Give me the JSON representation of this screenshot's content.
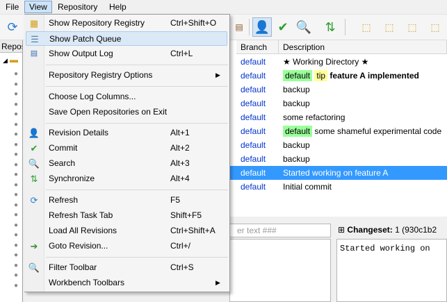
{
  "menubar": {
    "items": [
      {
        "label": "File"
      },
      {
        "label": "View"
      },
      {
        "label": "Repository"
      },
      {
        "label": "Help"
      }
    ]
  },
  "left_panel": {
    "header": "Repos"
  },
  "columns": {
    "branch": "Branch",
    "description": "Description"
  },
  "revisions": [
    {
      "branch": "default",
      "prefix": "★ ",
      "text": "Working Directory",
      "suffix": " ★"
    },
    {
      "branch": "default",
      "tags": [
        "default",
        "tip"
      ],
      "text": "feature A implemented"
    },
    {
      "branch": "default",
      "text": "backup"
    },
    {
      "branch": "default",
      "text": "backup"
    },
    {
      "branch": "default",
      "text": "some refactoring"
    },
    {
      "branch": "default",
      "tags": [
        "default"
      ],
      "text": "some shameful experimental code"
    },
    {
      "branch": "default",
      "text": "backup"
    },
    {
      "branch": "default",
      "text": "backup"
    },
    {
      "branch": "default",
      "text": "Started working on feature A"
    },
    {
      "branch": "default",
      "text": "Initial commit"
    }
  ],
  "filter": {
    "placeholder": "er text ###"
  },
  "changeset": {
    "toggle": "⊞",
    "label": "Changeset:",
    "value": "1 (930c1b2",
    "message": "Started working on"
  },
  "view_menu": {
    "items": [
      {
        "label": "Show Repository Registry",
        "shortcut": "Ctrl+Shift+O",
        "icon": "repository-registry-icon"
      },
      {
        "label": "Show Patch Queue",
        "shortcut": "",
        "icon": "patch-queue-icon"
      },
      {
        "label": "Show Output Log",
        "shortcut": "Ctrl+L",
        "icon": "output-log-icon"
      },
      {
        "label": "Repository Registry Options",
        "shortcut": "",
        "submenu": true
      },
      {
        "label": "Choose Log Columns...",
        "shortcut": ""
      },
      {
        "label": "Save Open Repositories on Exit",
        "shortcut": ""
      },
      {
        "label": "Revision Details",
        "shortcut": "Alt+1",
        "icon": "revision-details-icon"
      },
      {
        "label": "Commit",
        "shortcut": "Alt+2",
        "icon": "checkmark-icon"
      },
      {
        "label": "Search",
        "shortcut": "Alt+3",
        "icon": "search-icon"
      },
      {
        "label": "Synchronize",
        "shortcut": "Alt+4",
        "icon": "synchronize-icon"
      },
      {
        "label": "Refresh",
        "shortcut": "F5",
        "icon": "refresh-icon"
      },
      {
        "label": "Refresh Task Tab",
        "shortcut": "Shift+F5"
      },
      {
        "label": "Load All Revisions",
        "shortcut": "Ctrl+Shift+A"
      },
      {
        "label": "Goto Revision...",
        "shortcut": "Ctrl+/",
        "icon": "goto-revision-icon"
      },
      {
        "label": "Filter Toolbar",
        "shortcut": "Ctrl+S",
        "icon": "filter-icon"
      },
      {
        "label": "Workbench Toolbars",
        "shortcut": "",
        "submenu": true
      }
    ]
  },
  "colors": {
    "selection": "#3399ff",
    "branch_link": "#0033cc",
    "tag_default": "#99ff99",
    "tag_tip": "#ffff99",
    "menu_highlight": "#dbe9f7"
  }
}
